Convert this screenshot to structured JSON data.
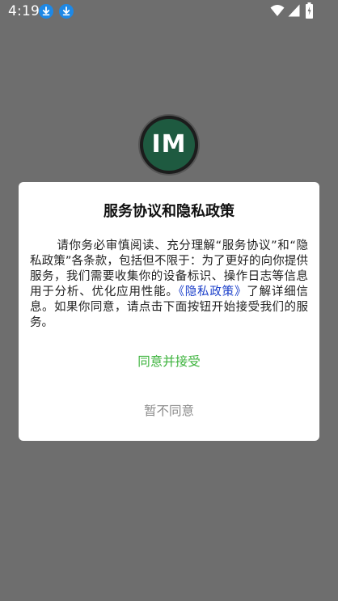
{
  "status_bar": {
    "time": "4:19",
    "notification_icons": [
      "download-icon",
      "download-icon"
    ],
    "system_icons": [
      "wifi-icon",
      "cellular-signal-icon",
      "battery-charging-icon"
    ]
  },
  "app_logo": {
    "text": "IM"
  },
  "dialog": {
    "title": "服务协议和隐私政策",
    "body_text": "请你务必审慎阅读、充分理解“服务协议”和“隐私政策”各条款，包括但不限于：为了更好的向你提供服务，我们需要收集你的设备标识、操作日志等信息用于分析、优化应用性能。",
    "policy_link": "《隐私政策》",
    "body_text_after_link": "了解详细信息。如果你同意，请点击下面按钮开始接受我们的服务。",
    "agree_label": "同意并接受",
    "decline_label": "暂不同意"
  },
  "colors": {
    "overlay_background": "#6e6e6e",
    "agree_green": "#3cb33c",
    "link_blue": "#1a3ec9",
    "decline_gray": "#8a8a8a",
    "download_badge_blue": "#1e88e5",
    "logo_green": "#1e5a40"
  }
}
